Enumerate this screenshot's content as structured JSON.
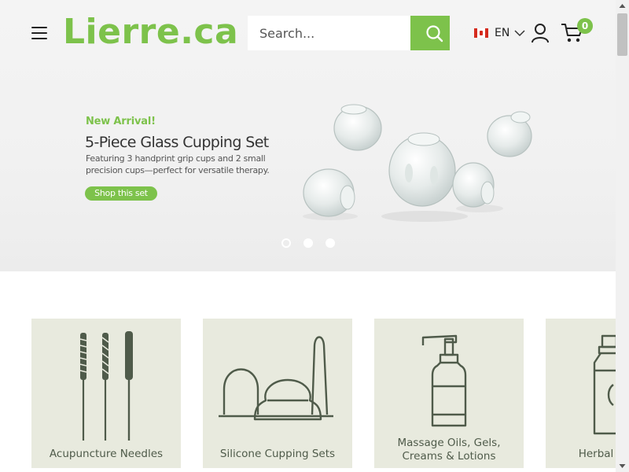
{
  "header": {
    "logo_text": "Lierre.ca",
    "search_placeholder": "Search...",
    "language": "EN",
    "cart_count": "0",
    "icons": [
      "menu-icon",
      "search-icon",
      "canada-flag-icon",
      "chevron-down-icon",
      "user-icon",
      "cart-icon"
    ]
  },
  "banner": {
    "kicker": "New Arrival!",
    "title": "5-Piece Glass Cupping Set",
    "description": "Featuring 3 handprint grip cups and 2 small precision cups—perfect for versatile therapy.",
    "cta": "Shop this set",
    "slide_count": 3,
    "active_slide": 1
  },
  "categories": [
    {
      "label": "Acupuncture Needles",
      "icon": "acupuncture-needles-icon"
    },
    {
      "label": "Silicone Cupping Sets",
      "icon": "silicone-cups-icon"
    },
    {
      "label_line1": "Massage Oils, Gels,",
      "label_line2": "Creams & Lotions",
      "icon": "pump-bottle-icon"
    },
    {
      "label": "Herbal",
      "icon": "herbal-bottle-icon"
    }
  ],
  "colors": {
    "brand": "#7dc24b",
    "category_bg": "#e8eade",
    "icon_stroke": "#4f5b4a"
  }
}
